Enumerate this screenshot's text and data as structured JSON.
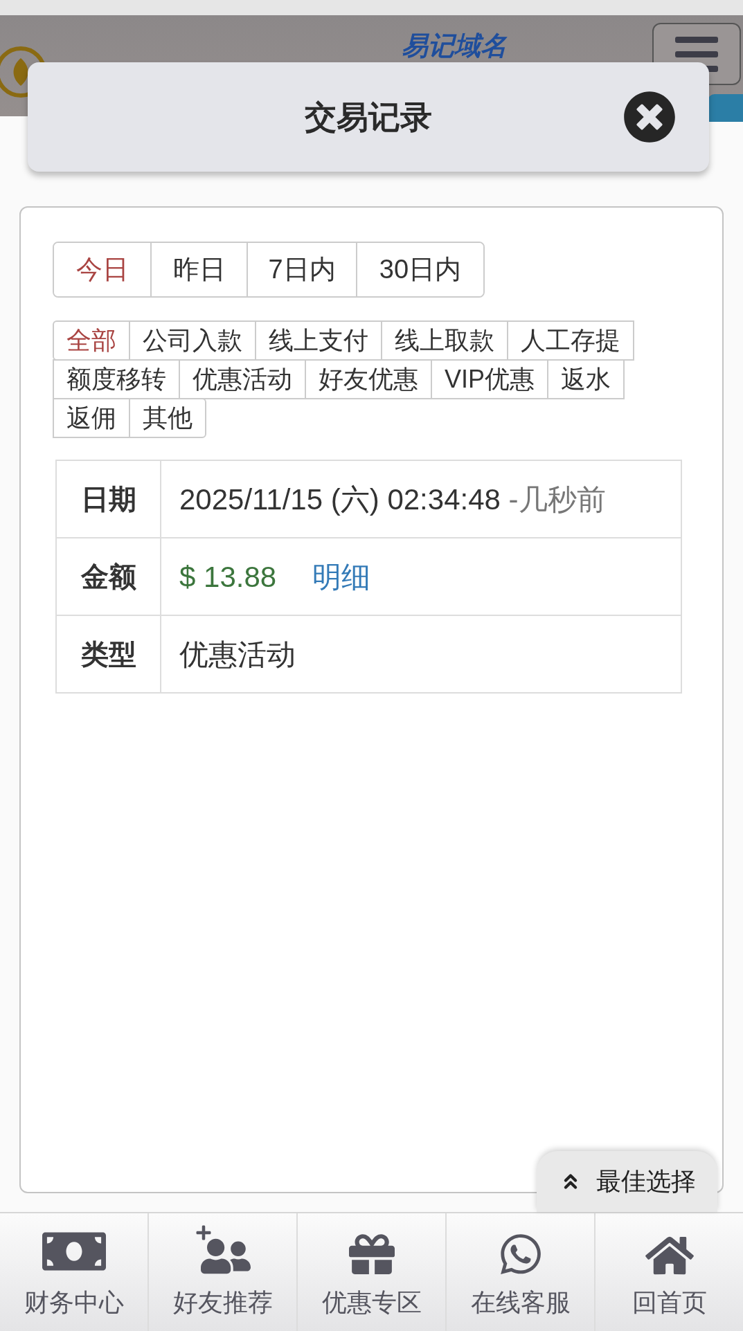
{
  "header": {
    "site_link": "易记域名"
  },
  "dialog": {
    "title": "交易记录"
  },
  "date_tabs": [
    {
      "label": "今日",
      "selected": true
    },
    {
      "label": "昨日",
      "selected": false
    },
    {
      "label": "7日内",
      "selected": false
    },
    {
      "label": "30日内",
      "selected": false
    }
  ],
  "filters": [
    {
      "label": "全部",
      "selected": true
    },
    {
      "label": "公司入款",
      "selected": false
    },
    {
      "label": "线上支付",
      "selected": false
    },
    {
      "label": "线上取款",
      "selected": false
    },
    {
      "label": "人工存提",
      "selected": false
    },
    {
      "label": "额度移转",
      "selected": false
    },
    {
      "label": "优惠活动",
      "selected": false
    },
    {
      "label": "好友优惠",
      "selected": false
    },
    {
      "label": "VIP优惠",
      "selected": false
    },
    {
      "label": "返水",
      "selected": false
    },
    {
      "label": "返佣",
      "selected": false
    },
    {
      "label": "其他",
      "selected": false
    }
  ],
  "record": [
    {
      "kind": "date",
      "label": "日期",
      "value": "2025/11/15 (六) 02:34:48",
      "relative": "-几秒前"
    },
    {
      "kind": "amount",
      "label": "金额",
      "value": "$ 13.88",
      "link": "明细"
    },
    {
      "kind": "text",
      "label": "类型",
      "value": "优惠活动"
    }
  ],
  "float_button": {
    "label": "最佳选择"
  },
  "bottom_nav": [
    {
      "label": "财务中心"
    },
    {
      "label": "好友推荐"
    },
    {
      "label": "优惠专区"
    },
    {
      "label": "在线客服"
    },
    {
      "label": "回首页"
    }
  ]
}
